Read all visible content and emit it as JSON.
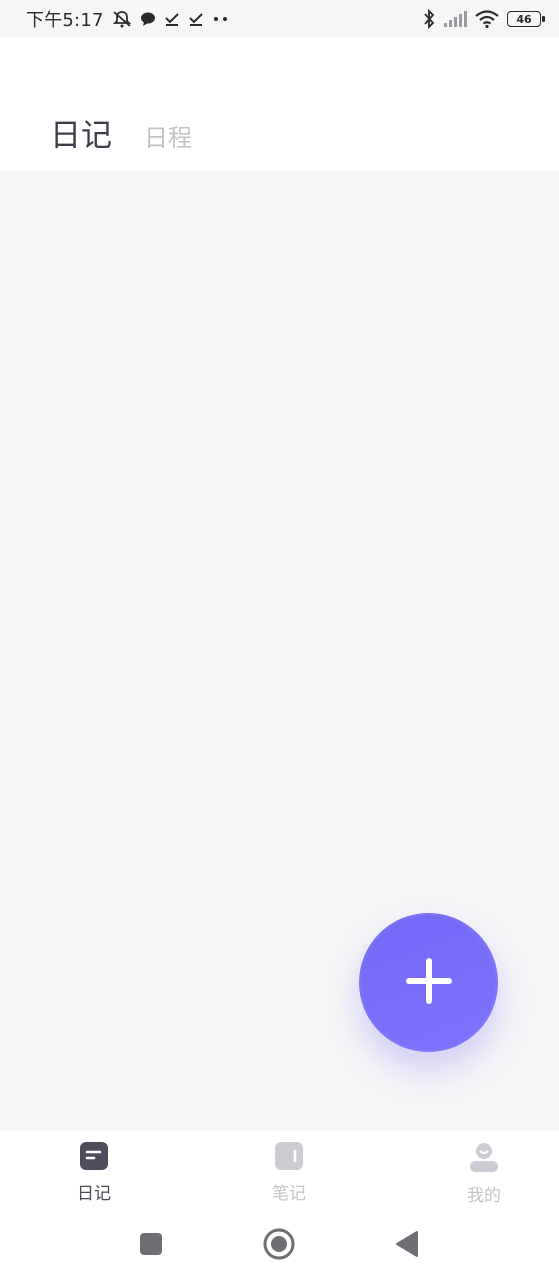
{
  "status_bar": {
    "time": "下午5:17",
    "battery": "46"
  },
  "header": {
    "tabs": [
      {
        "label": "日记",
        "active": true
      },
      {
        "label": "日程",
        "active": false
      }
    ]
  },
  "fab": {
    "icon": "plus-icon"
  },
  "bottom_nav": {
    "items": [
      {
        "label": "日记",
        "icon": "diary-icon",
        "active": true
      },
      {
        "label": "笔记",
        "icon": "notebook-icon",
        "active": false
      },
      {
        "label": "我的",
        "icon": "profile-icon",
        "active": false
      }
    ]
  },
  "system_nav": {
    "buttons": [
      "recents-button",
      "home-button",
      "back-button"
    ]
  },
  "colors": {
    "accent": "#7368f6",
    "text_primary": "#3e3e4a",
    "text_muted": "#c3c3ca",
    "background": "#f6f6f7"
  }
}
